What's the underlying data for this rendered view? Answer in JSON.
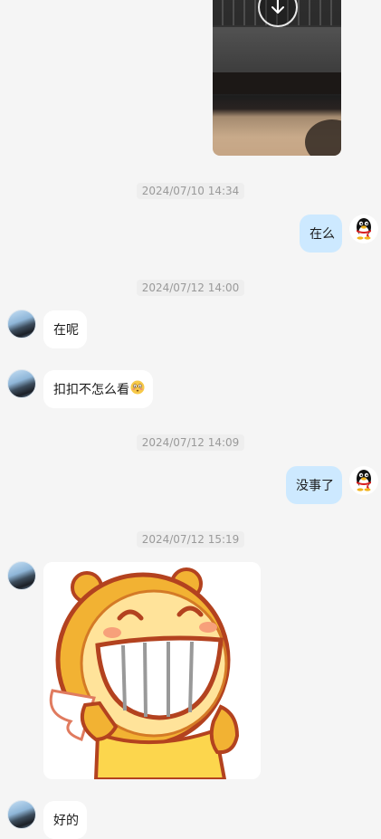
{
  "messages": {
    "timestamp_1": "2024/07/10 14:34",
    "msg_me_1": "在么",
    "timestamp_2": "2024/07/12 14:00",
    "msg_them_1": "在呢",
    "msg_them_2": "扣扣不怎么看",
    "timestamp_3": "2024/07/12 14:09",
    "msg_me_2": "没事了",
    "timestamp_4": "2024/07/12 15:19",
    "msg_them_3": "好的"
  },
  "icons": {
    "download": "download-icon",
    "flushed_emoji": "flushed-face-emoji-icon",
    "qq_penguin": "qq-penguin-avatar-icon"
  },
  "colors": {
    "background": "#f5f5f5",
    "bubble_self": "#cde9ff",
    "bubble_other": "#ffffff",
    "timestamp_text": "#9a9a9a"
  }
}
